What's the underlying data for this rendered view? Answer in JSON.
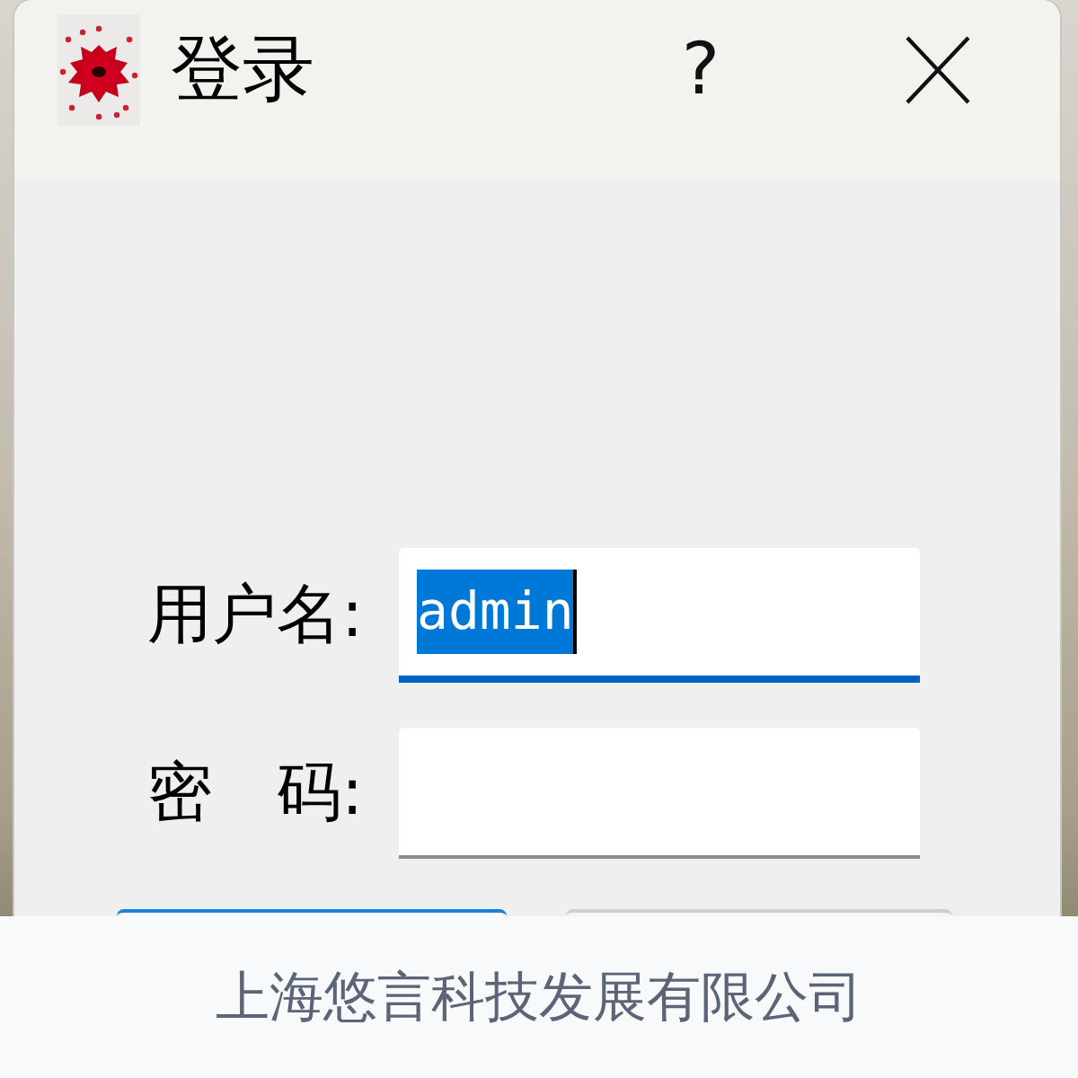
{
  "window": {
    "title": "登录",
    "help": "?"
  },
  "fields": [
    {
      "kind": "text",
      "label": "用户名:",
      "value": "admin",
      "focused": true,
      "text_selected": true
    },
    {
      "kind": "password",
      "label": "密　码:",
      "focused": false
    }
  ],
  "buttons": [
    {
      "kind": "primary"
    },
    {
      "kind": "secondary"
    }
  ],
  "footer": {
    "text": "上海悠言科技发展有限公司"
  }
}
